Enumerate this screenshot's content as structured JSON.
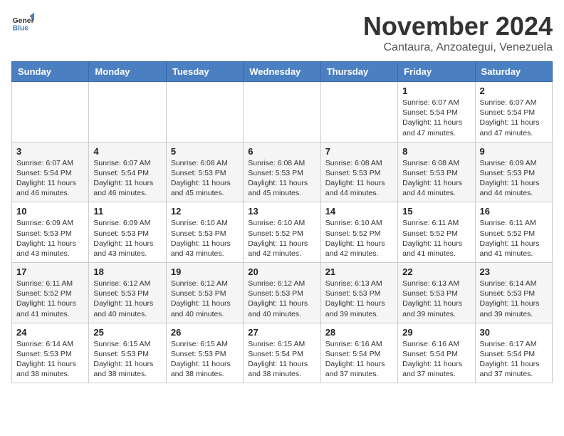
{
  "header": {
    "logo_line1": "General",
    "logo_line2": "Blue",
    "month": "November 2024",
    "location": "Cantaura, Anzoategui, Venezuela"
  },
  "weekdays": [
    "Sunday",
    "Monday",
    "Tuesday",
    "Wednesday",
    "Thursday",
    "Friday",
    "Saturday"
  ],
  "weeks": [
    [
      {
        "day": "",
        "info": ""
      },
      {
        "day": "",
        "info": ""
      },
      {
        "day": "",
        "info": ""
      },
      {
        "day": "",
        "info": ""
      },
      {
        "day": "",
        "info": ""
      },
      {
        "day": "1",
        "info": "Sunrise: 6:07 AM\nSunset: 5:54 PM\nDaylight: 11 hours and 47 minutes."
      },
      {
        "day": "2",
        "info": "Sunrise: 6:07 AM\nSunset: 5:54 PM\nDaylight: 11 hours and 47 minutes."
      }
    ],
    [
      {
        "day": "3",
        "info": "Sunrise: 6:07 AM\nSunset: 5:54 PM\nDaylight: 11 hours and 46 minutes."
      },
      {
        "day": "4",
        "info": "Sunrise: 6:07 AM\nSunset: 5:54 PM\nDaylight: 11 hours and 46 minutes."
      },
      {
        "day": "5",
        "info": "Sunrise: 6:08 AM\nSunset: 5:53 PM\nDaylight: 11 hours and 45 minutes."
      },
      {
        "day": "6",
        "info": "Sunrise: 6:08 AM\nSunset: 5:53 PM\nDaylight: 11 hours and 45 minutes."
      },
      {
        "day": "7",
        "info": "Sunrise: 6:08 AM\nSunset: 5:53 PM\nDaylight: 11 hours and 44 minutes."
      },
      {
        "day": "8",
        "info": "Sunrise: 6:08 AM\nSunset: 5:53 PM\nDaylight: 11 hours and 44 minutes."
      },
      {
        "day": "9",
        "info": "Sunrise: 6:09 AM\nSunset: 5:53 PM\nDaylight: 11 hours and 44 minutes."
      }
    ],
    [
      {
        "day": "10",
        "info": "Sunrise: 6:09 AM\nSunset: 5:53 PM\nDaylight: 11 hours and 43 minutes."
      },
      {
        "day": "11",
        "info": "Sunrise: 6:09 AM\nSunset: 5:53 PM\nDaylight: 11 hours and 43 minutes."
      },
      {
        "day": "12",
        "info": "Sunrise: 6:10 AM\nSunset: 5:53 PM\nDaylight: 11 hours and 43 minutes."
      },
      {
        "day": "13",
        "info": "Sunrise: 6:10 AM\nSunset: 5:52 PM\nDaylight: 11 hours and 42 minutes."
      },
      {
        "day": "14",
        "info": "Sunrise: 6:10 AM\nSunset: 5:52 PM\nDaylight: 11 hours and 42 minutes."
      },
      {
        "day": "15",
        "info": "Sunrise: 6:11 AM\nSunset: 5:52 PM\nDaylight: 11 hours and 41 minutes."
      },
      {
        "day": "16",
        "info": "Sunrise: 6:11 AM\nSunset: 5:52 PM\nDaylight: 11 hours and 41 minutes."
      }
    ],
    [
      {
        "day": "17",
        "info": "Sunrise: 6:11 AM\nSunset: 5:52 PM\nDaylight: 11 hours and 41 minutes."
      },
      {
        "day": "18",
        "info": "Sunrise: 6:12 AM\nSunset: 5:53 PM\nDaylight: 11 hours and 40 minutes."
      },
      {
        "day": "19",
        "info": "Sunrise: 6:12 AM\nSunset: 5:53 PM\nDaylight: 11 hours and 40 minutes."
      },
      {
        "day": "20",
        "info": "Sunrise: 6:12 AM\nSunset: 5:53 PM\nDaylight: 11 hours and 40 minutes."
      },
      {
        "day": "21",
        "info": "Sunrise: 6:13 AM\nSunset: 5:53 PM\nDaylight: 11 hours and 39 minutes."
      },
      {
        "day": "22",
        "info": "Sunrise: 6:13 AM\nSunset: 5:53 PM\nDaylight: 11 hours and 39 minutes."
      },
      {
        "day": "23",
        "info": "Sunrise: 6:14 AM\nSunset: 5:53 PM\nDaylight: 11 hours and 39 minutes."
      }
    ],
    [
      {
        "day": "24",
        "info": "Sunrise: 6:14 AM\nSunset: 5:53 PM\nDaylight: 11 hours and 38 minutes."
      },
      {
        "day": "25",
        "info": "Sunrise: 6:15 AM\nSunset: 5:53 PM\nDaylight: 11 hours and 38 minutes."
      },
      {
        "day": "26",
        "info": "Sunrise: 6:15 AM\nSunset: 5:53 PM\nDaylight: 11 hours and 38 minutes."
      },
      {
        "day": "27",
        "info": "Sunrise: 6:15 AM\nSunset: 5:54 PM\nDaylight: 11 hours and 38 minutes."
      },
      {
        "day": "28",
        "info": "Sunrise: 6:16 AM\nSunset: 5:54 PM\nDaylight: 11 hours and 37 minutes."
      },
      {
        "day": "29",
        "info": "Sunrise: 6:16 AM\nSunset: 5:54 PM\nDaylight: 11 hours and 37 minutes."
      },
      {
        "day": "30",
        "info": "Sunrise: 6:17 AM\nSunset: 5:54 PM\nDaylight: 11 hours and 37 minutes."
      }
    ]
  ]
}
